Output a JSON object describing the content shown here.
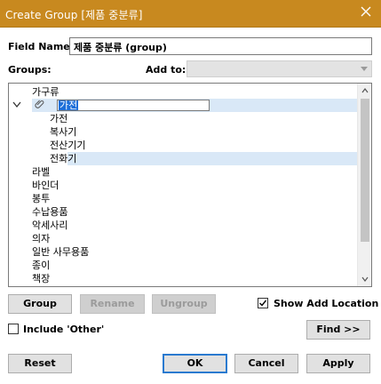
{
  "window": {
    "title": "Create Group [제품 중분류]",
    "close_label": "×"
  },
  "field_name": {
    "label": "Field Name:",
    "value": "제품 중분류 (group)"
  },
  "groups_label": "Groups:",
  "add_to": {
    "label": "Add to:",
    "value": ""
  },
  "tree": {
    "items": [
      {
        "label": "가구류",
        "level": 0
      },
      {
        "label": "가전",
        "level": 1,
        "editing": true
      },
      {
        "label": "가전",
        "level": 2
      },
      {
        "label": "복사기",
        "level": 2
      },
      {
        "label": "전산기기",
        "level": 2
      },
      {
        "label": "전화기",
        "level": 2,
        "selected": true
      },
      {
        "label": "라벨",
        "level": 0
      },
      {
        "label": "바인더",
        "level": 0
      },
      {
        "label": "봉투",
        "level": 0
      },
      {
        "label": "수납용품",
        "level": 0
      },
      {
        "label": "악세사리",
        "level": 0
      },
      {
        "label": "의자",
        "level": 0
      },
      {
        "label": "일반 사무용품",
        "level": 0
      },
      {
        "label": "종이",
        "level": 0
      },
      {
        "label": "책장",
        "level": 0
      }
    ]
  },
  "buttons": {
    "group": "Group",
    "rename": "Rename",
    "ungroup": "Ungroup",
    "find": "Find >>",
    "reset": "Reset",
    "ok": "OK",
    "cancel": "Cancel",
    "apply": "Apply"
  },
  "show_add_location": {
    "label": "Show Add Location",
    "checked": true
  },
  "include_other": {
    "label": "Include 'Other'",
    "checked": false
  },
  "colors": {
    "titlebar": "#c8891f",
    "selection": "#d9e8f7",
    "edit_highlight": "#1e6fd9"
  }
}
